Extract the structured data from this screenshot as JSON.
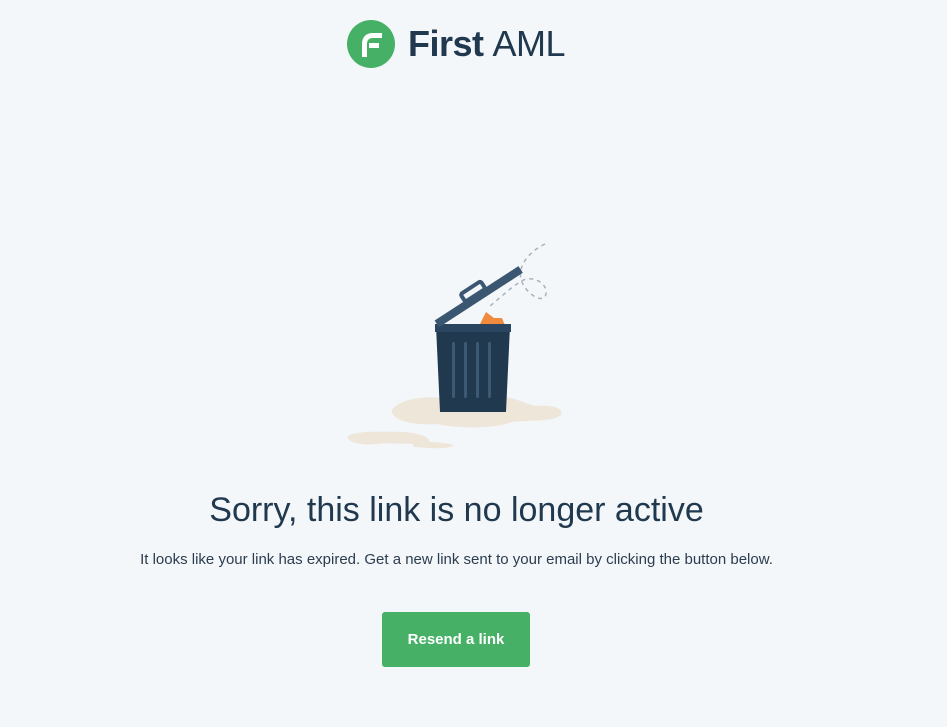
{
  "brand": {
    "name_bold": "First",
    "name_light": "AML",
    "mark_icon": "first-aml-logo-icon",
    "primary_color": "#46b166",
    "text_color": "#21394f"
  },
  "illustration": {
    "icon": "trash-can-icon"
  },
  "message": {
    "headline": "Sorry, this link is no longer active",
    "body": "It looks like your link has expired. Get a new link sent to your email by clicking the button below."
  },
  "actions": {
    "resend_label": "Resend a link"
  }
}
